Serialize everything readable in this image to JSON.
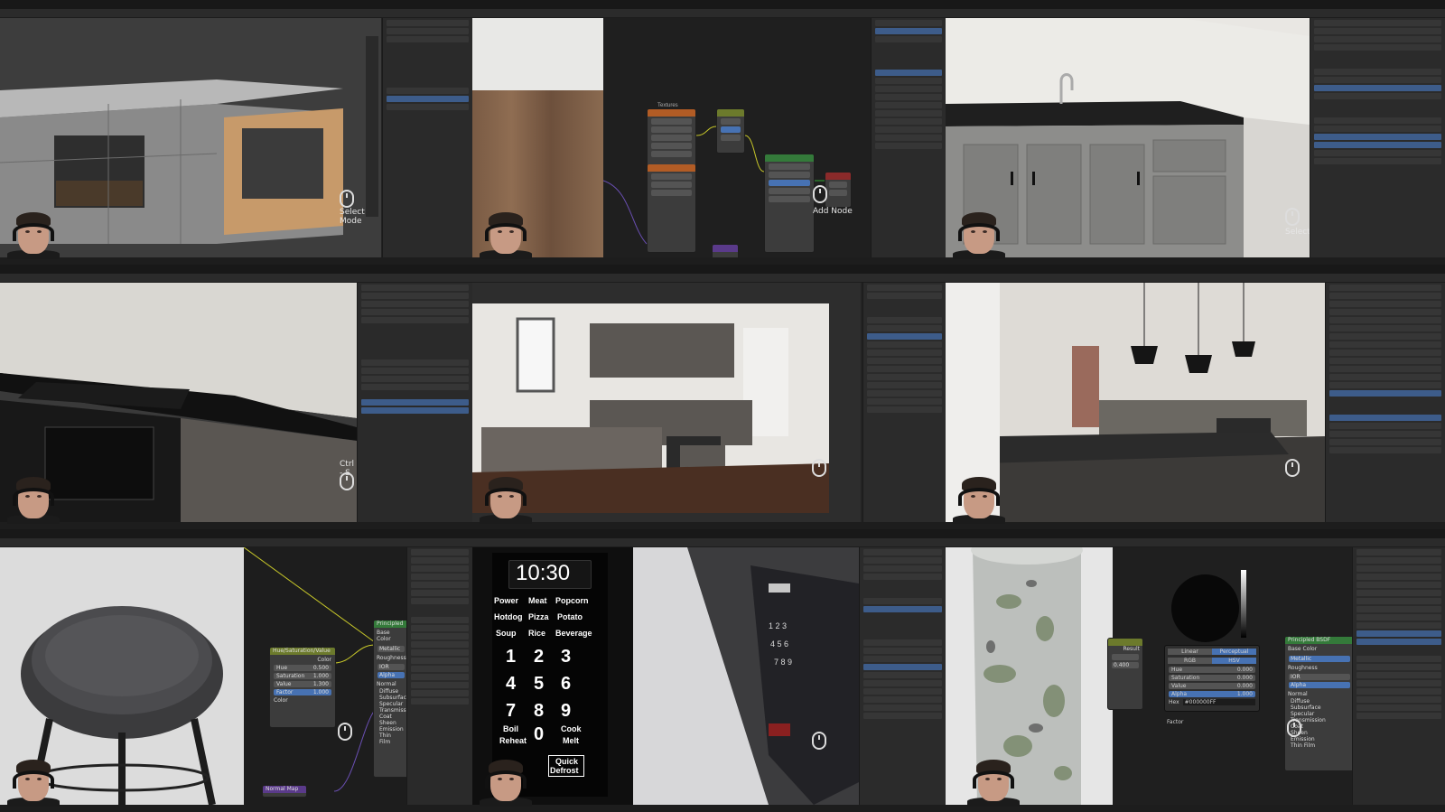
{
  "panels": {
    "p1": {
      "hint": "Select Mode"
    },
    "p2": {
      "hint": "Add Node",
      "node_title": "Textures"
    },
    "p3": {
      "hint": "Select"
    },
    "p4": {
      "hint": "Ctrl - S"
    },
    "p7": {
      "node_hue_sat": "Hue/Saturation/Value",
      "rows": [
        {
          "label": "Hue",
          "value": "0.500"
        },
        {
          "label": "Saturation",
          "value": "1.000"
        },
        {
          "label": "Value",
          "value": "1.300"
        },
        {
          "label": "Factor",
          "value": "1.000"
        }
      ],
      "color_label": "Color",
      "color_out": "Color",
      "bsdf_title": "Principled",
      "bsdf_inputs": [
        "Base Color",
        "Metallic",
        "Roughness",
        "IOR",
        "Alpha",
        "Normal"
      ],
      "bsdf_subs": [
        "Diffuse",
        "Subsurface",
        "Specular",
        "Transmission",
        "Coat",
        "Sheen",
        "Emission",
        "Thin Film"
      ],
      "normal_map": "Normal Map"
    },
    "p8": {
      "time": "10:30",
      "buttons_row1": [
        "Power",
        "Meat",
        "Popcorn"
      ],
      "buttons_row2": [
        "Hotdog",
        "Pizza",
        "Potato"
      ],
      "buttons_row3": [
        "Soup",
        "Rice",
        "Beverage"
      ],
      "digits_row1": [
        "1",
        "2",
        "3"
      ],
      "digits_row2": [
        "4",
        "5",
        "6"
      ],
      "digits_row3": [
        "7",
        "8",
        "9"
      ],
      "labels_row4": [
        "Boil",
        "Cook"
      ],
      "labels_row5": [
        "Reheat",
        "0",
        "Melt"
      ],
      "quick": "Quick",
      "defrost": "Defrost"
    },
    "p9": {
      "tabs": [
        "Linear",
        "Perceptual"
      ],
      "modes": [
        "RGB",
        "HSV"
      ],
      "hsv": [
        {
          "label": "Hue",
          "value": "0.000"
        },
        {
          "label": "Saturation",
          "value": "0.000"
        },
        {
          "label": "Value",
          "value": "0.000"
        },
        {
          "label": "Alpha",
          "value": "1.000"
        }
      ],
      "hex_label": "Hex",
      "hex": "#000000FF",
      "result": "Result",
      "factor": "Factor",
      "bsdf_title": "Principled BSDF",
      "bsdf_inputs": [
        "Base Color",
        "Metallic",
        "Roughness",
        "IOR",
        "Alpha",
        "Normal"
      ],
      "bsdf_subs": [
        "Diffuse",
        "Subsurface",
        "Specular",
        "Transmission",
        "Coat",
        "Sheen",
        "Emission",
        "Thin Film"
      ],
      "value_field": "0.400"
    }
  }
}
